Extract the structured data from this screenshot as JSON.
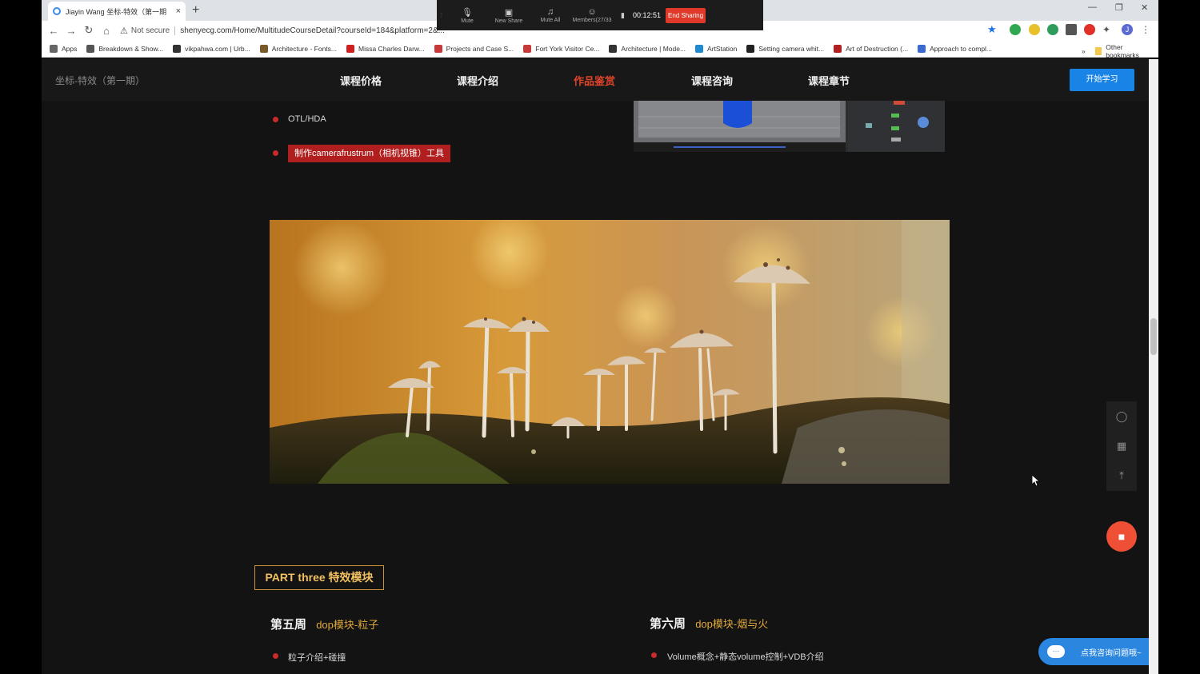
{
  "browser": {
    "tab_title": "Jiayin Wang 坐标-特效（第一期",
    "tab_close": "×",
    "new_tab": "+",
    "not_secure": "Not secure",
    "url": "shenyecg.com/Home/MultitudeCourseDetail?courseId=184&platform=2&..."
  },
  "bookmarks": [
    {
      "label": "Apps",
      "color": "#666666"
    },
    {
      "label": "Breakdown & Show...",
      "color": "#555555"
    },
    {
      "label": "vikpahwa.com | Urb...",
      "color": "#333333"
    },
    {
      "label": "Architecture - Fonts...",
      "color": "#7a5a2a"
    },
    {
      "label": "Missa Charles Darw...",
      "color": "#d01f1f"
    },
    {
      "label": "Projects and Case S...",
      "color": "#c83a3a"
    },
    {
      "label": "Fort York Visitor Ce...",
      "color": "#c83a3a"
    },
    {
      "label": "Architecture | Mode...",
      "color": "#333333"
    },
    {
      "label": "ArtStation",
      "color": "#1f8ad1"
    },
    {
      "label": "Setting camera whit...",
      "color": "#222222"
    },
    {
      "label": "Art of Destruction (...",
      "color": "#b02020"
    },
    {
      "label": "Approach to compl...",
      "color": "#3a6ad0"
    }
  ],
  "bookmarks_more": "»",
  "bookmarks_other": "Other bookmarks",
  "zoom": {
    "items": [
      {
        "label": "Mute",
        "icon": "microphone-icon"
      },
      {
        "label": "New Share",
        "icon": "share-icon"
      },
      {
        "label": "Mute All",
        "icon": "mute-all-icon"
      },
      {
        "label": "Members(27/33",
        "icon": "members-icon"
      }
    ],
    "timer": "00:12:51",
    "end_label": "End Sharing"
  },
  "site": {
    "logo": "坐标-特效（第一期）",
    "nav": [
      "课程价格",
      "课程介绍",
      "作品鉴赏",
      "课程咨询",
      "课程章节"
    ],
    "active_nav": 2,
    "start_button": "开始学习",
    "accent": "#e0442a"
  },
  "content": {
    "bullet_otl": "OTL/HDA",
    "bullet_camera": "制作camerafrustrum（相机视锥）工具",
    "part_title": "PART three 特效模块",
    "week5_title": "第五周",
    "week5_sub": "dop模块-粒子",
    "week5_item": "粒子介绍+碰撞",
    "week6_title": "第六周",
    "week6_sub": "dop模块-烟与火",
    "week6_item": "Volume概念+静态volume控制+VDB介绍"
  },
  "widgets": {
    "consult_label": "点我咨询问题哦~"
  }
}
